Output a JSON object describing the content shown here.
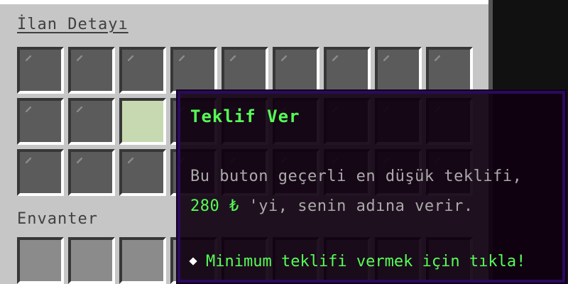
{
  "window": {
    "title": "İlan Detayı"
  },
  "inventory": {
    "label": "Envanter"
  },
  "listing_grid": {
    "rows": 3,
    "cols": 9,
    "highlighted": [
      {
        "row": 1,
        "col": 2
      }
    ]
  },
  "tooltip": {
    "title": "Teklif Ver",
    "line1": "Bu buton geçerli en düşük teklifi,",
    "price": "280 ₺",
    "line2_suffix": " 'yi, senin adına verir.",
    "action": "Minimum teklifi vermek için tıkla!"
  },
  "colors": {
    "panel": "#c6c6c6",
    "slot_dark": "#5b5b5b",
    "highlight": "#c7d9b0",
    "tooltip_bg": "#100010",
    "tooltip_border": "#2a0a5e",
    "accent_green": "#55ff55",
    "text_gray": "#aaaaaa"
  },
  "icons": {
    "pane": "glass-pane-icon",
    "bullet": "diamond-bullet-icon"
  }
}
